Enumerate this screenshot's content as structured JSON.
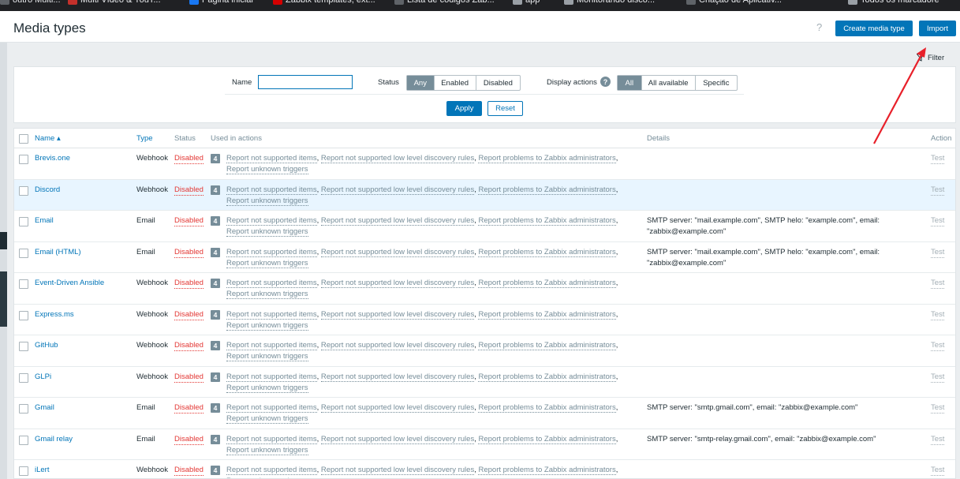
{
  "browser": {
    "bookmarks": [
      {
        "label": "outro Multi...",
        "color": "#5f6368"
      },
      {
        "label": "Multi Vídeo & YouT...",
        "color": "#c4302b"
      },
      {
        "label": "Página inicial",
        "color": "#1877f2"
      },
      {
        "label": "Zabbix templates, ext...",
        "color": "#d40000"
      },
      {
        "label": "Lista de códigos Zab...",
        "color": "#5f6368"
      },
      {
        "label": "app",
        "color": "#9aa0a6"
      },
      {
        "label": "Monitorando disco...",
        "color": "#9aa0a6"
      },
      {
        "label": "Criação de Aplicativ...",
        "color": "#5f6368"
      },
      {
        "label": "Todos os marcadore",
        "color": "#9aa0a6"
      }
    ]
  },
  "header": {
    "title": "Media types",
    "help": "?",
    "create_label": "Create media type",
    "import_label": "Import"
  },
  "filter": {
    "tab_label": "Filter",
    "name_label": "Name",
    "name_value": "",
    "status_label": "Status",
    "status_options": [
      "Any",
      "Enabled",
      "Disabled"
    ],
    "status_selected": "Any",
    "display_actions_label": "Display actions",
    "display_actions_help": "?",
    "display_options": [
      "All",
      "All available",
      "Specific"
    ],
    "display_selected": "All",
    "apply_label": "Apply",
    "reset_label": "Reset"
  },
  "table": {
    "columns": {
      "name": "Name ▴",
      "type": "Type",
      "status": "Status",
      "used": "Used in actions",
      "details": "Details",
      "action": "Action"
    },
    "action_links": [
      "Report not supported items",
      "Report not supported low level discovery rules",
      "Report problems to Zabbix administrators",
      "Report unknown triggers"
    ],
    "rows": [
      {
        "name": "Brevis.one",
        "type": "Webhook",
        "status": "Disabled",
        "count": "4",
        "details_1": "",
        "details_2": "",
        "test": "Test"
      },
      {
        "name": "Discord",
        "type": "Webhook",
        "status": "Disabled",
        "count": "4",
        "details_1": "",
        "details_2": "",
        "test": "Test"
      },
      {
        "name": "Email",
        "type": "Email",
        "status": "Disabled",
        "count": "4",
        "details_1": "SMTP server: \"mail.example.com\", SMTP helo: \"example.com\", email:",
        "details_2": "\"zabbix@example.com\"",
        "test": "Test"
      },
      {
        "name": "Email (HTML)",
        "type": "Email",
        "status": "Disabled",
        "count": "4",
        "details_1": "SMTP server: \"mail.example.com\", SMTP helo: \"example.com\", email:",
        "details_2": "\"zabbix@example.com\"",
        "test": "Test"
      },
      {
        "name": "Event-Driven Ansible",
        "type": "Webhook",
        "status": "Disabled",
        "count": "4",
        "details_1": "",
        "details_2": "",
        "test": "Test"
      },
      {
        "name": "Express.ms",
        "type": "Webhook",
        "status": "Disabled",
        "count": "4",
        "details_1": "",
        "details_2": "",
        "test": "Test"
      },
      {
        "name": "GitHub",
        "type": "Webhook",
        "status": "Disabled",
        "count": "4",
        "details_1": "",
        "details_2": "",
        "test": "Test"
      },
      {
        "name": "GLPi",
        "type": "Webhook",
        "status": "Disabled",
        "count": "4",
        "details_1": "",
        "details_2": "",
        "test": "Test"
      },
      {
        "name": "Gmail",
        "type": "Email",
        "status": "Disabled",
        "count": "4",
        "details_1": "SMTP server: \"smtp.gmail.com\", email: \"zabbix@example.com\"",
        "details_2": "",
        "test": "Test"
      },
      {
        "name": "Gmail relay",
        "type": "Email",
        "status": "Disabled",
        "count": "4",
        "details_1": "SMTP server: \"smtp-relay.gmail.com\", email: \"zabbix@example.com\"",
        "details_2": "",
        "test": "Test"
      },
      {
        "name": "iLert",
        "type": "Webhook",
        "status": "Disabled",
        "count": "4",
        "details_1": "",
        "details_2": "",
        "test": "Test"
      }
    ],
    "highlighted_row": 1
  },
  "annotation": {
    "arrow_color": "#e8202a"
  }
}
